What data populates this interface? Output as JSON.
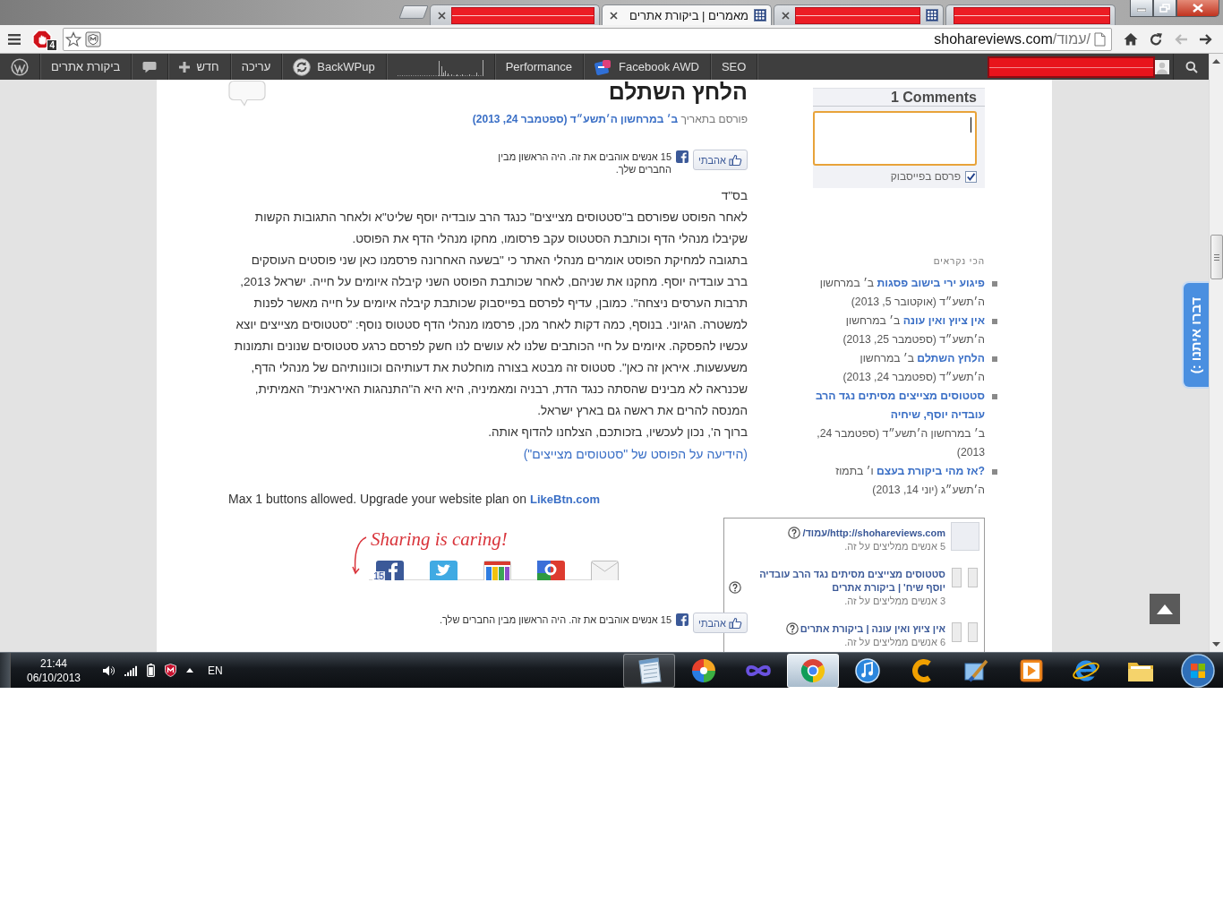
{
  "browser": {
    "tabs": [
      {
        "redacted": true,
        "closable": true,
        "favicon": false,
        "selected": false
      },
      {
        "redacted": false,
        "title": "מאמרים | ביקורת אתרים",
        "closable": true,
        "favicon": true,
        "selected": true
      },
      {
        "redacted": true,
        "closable": true,
        "favicon": true,
        "selected": false
      },
      {
        "redacted": true,
        "closable": false,
        "favicon": false,
        "selected": false
      }
    ],
    "extension_badge": "4",
    "address_bar": {
      "host": "shohareviews.com",
      "path": "/עמוד/"
    },
    "navigation": {
      "forward": {
        "disabled": true
      },
      "back": {
        "disabled": false
      }
    }
  },
  "admin_bar": {
    "items": [
      {
        "kind": "link",
        "label": "SEO"
      },
      {
        "kind": "facebook",
        "label": "Facebook AWD"
      },
      {
        "kind": "link",
        "label": "Performance"
      },
      {
        "kind": "graph"
      },
      {
        "kind": "backup",
        "label": "BackWPup"
      },
      {
        "kind": "link",
        "label": "עריכה"
      },
      {
        "kind": "new",
        "label": "חדש"
      },
      {
        "kind": "comments"
      },
      {
        "kind": "link",
        "label": "ביקורת אתרים"
      },
      {
        "kind": "logo"
      }
    ],
    "account": {
      "redacted": true
    }
  },
  "article": {
    "title": "הלחץ השתלם",
    "posted_label": "פורסם בתאריך",
    "date": "ב׳ במרחשון ה׳תשע״ד (ספטמבר 24, 2013)",
    "like_box_top": {
      "button": "אהבתי",
      "text": "15 אנשים אוהבים את זה. היה הראשון מבין החברים שלך."
    },
    "paragraphs": [
      [
        "בס\"ד"
      ],
      [
        "לאחר הפוסט שפורסם ב\"סטטוסים מצייצים\" כנגד הרב עובדיה יוסף שליט\"א ולאחר התגובות הקשות",
        "שקיבלו מנהלי הדף וכותבת הסטטוס עקב פרסומו, מחקו מנהלי הדף את הפוסט."
      ],
      [
        "בתגובה למחיקת הפוסט אומרים מנהלי האתר כי \"בשעה האחרונה פרסמנו כאן שני פוסטים העוסקים",
        "ברב עובדיה יוסף. מחקנו את שניהם, לאחר שכותבת הפוסט השני קיבלה איומים על חייה. ישראל 2013,",
        "תרבות הערסים ניצחה\". כמובן, עדיף לפרסם בפייסבוק שכותבת קיבלה איומים על חייה מאשר לפנות",
        "למשטרה. הגיוני. בנוסף, כמה דקות לאחר מכן, פרסמו מנהלי הדף סטטוס נוסף: \"סטטוסים מצייצים יוצא",
        "עכשיו להפסקה. איומים על חיי הכותבים שלנו לא עושים לנו חשק לפרסם כרגע סטטוסים שנונים ותמונות",
        "משעשעות. איראן זה כאן\". סטטוס זה מבטא בצורה מוחלטת את דעותיהם וכוונותיהם של מנהלי הדף,",
        "שכנראה לא מבינים שהסתה כנגד הדת, רבניה ומאמיניה, היא היא ה\"התנהגות האיראנית\" האמיתית,",
        "המנסה להרים את ראשה גם בארץ ישראל."
      ],
      [
        "ברוך ה', נכון לעכשיו, בזכותכם, הצלחנו להדוף אותה."
      ]
    ],
    "source_link": "(הידיעה על הפוסט של \"סטטוסים מצייצים\")",
    "upgrade_notice": {
      "text": "Max 1 buttons allowed. Upgrade your website plan on",
      "link": "LikeBtn.com"
    },
    "sharing": {
      "caption": "Sharing is caring!",
      "services": [
        {
          "kind": "facebook",
          "count": "15"
        },
        {
          "kind": "twitter"
        },
        {
          "kind": "bookmarks"
        },
        {
          "kind": "google"
        },
        {
          "kind": "email"
        }
      ]
    },
    "like_box_bottom": {
      "button": "אהבתי",
      "text": "15 אנשים אוהבים את זה. היה הראשון מבין החברים שלך."
    }
  },
  "sidebar": {
    "comments": {
      "title": "1 Comments",
      "field": {
        "focused": true
      },
      "post_to_facebook": {
        "label": "פרסם בפייסבוק",
        "checked": true
      }
    },
    "most_read": {
      "heading": "הכי נקראים",
      "items": [
        {
          "title": "פיגוע ירי בישוב פסגות",
          "date": "ב׳ במרחשון ה׳תשע״ד (אוקטובר 5, 2013)"
        },
        {
          "title": "אין ציוץ ואין עונה",
          "date": "ב׳ במרחשון ה׳תשע״ד (ספטמבר 25, 2013)"
        },
        {
          "title": "הלחץ השתלם",
          "date": "ב׳ במרחשון ה׳תשע״ד (ספטמבר 24, 2013)"
        },
        {
          "title": "סטטוסים מצייצים מסיתים נגד הרב עובדיה יוסף, שיחיה",
          "date": "ב׳ במרחשון ה׳תשע״ד (ספטמבר 24, 2013)"
        },
        {
          "title": "אז מהי ביקורת בעצם?",
          "date": "ו׳ בתמוז ה׳תשע״ג (יוני 14, 2013)"
        }
      ]
    },
    "recommendations": [
      {
        "kind": "page",
        "title": "http://shohareviews.com/עמוד/",
        "count": "5 אנשים ממליצים על זה."
      },
      {
        "kind": "article",
        "title": "סטטוסים מצייצים מסיתים נגד הרב עובדיה יוסף שיח' | ביקורת אתרים",
        "count": "3 אנשים ממליצים על זה."
      },
      {
        "kind": "article",
        "title": "אין ציוץ ואין עונה | ביקורת אתרים",
        "count": "6 אנשים ממליצים על זה."
      }
    ]
  },
  "feedback_tab": "דברו איתנו :)",
  "taskbar": {
    "time": "21:44",
    "date": "06/10/2013",
    "language": "EN",
    "apps": [
      {
        "running": true,
        "selected": false
      },
      {
        "running": false,
        "selected": false
      },
      {
        "running": false,
        "selected": false
      },
      {
        "running": true,
        "selected": true
      },
      {
        "running": false,
        "selected": false
      },
      {
        "running": false,
        "selected": false
      },
      {
        "running": false,
        "selected": false
      },
      {
        "running": false,
        "selected": false
      },
      {
        "running": false,
        "selected": false
      },
      {
        "running": false,
        "selected": false
      }
    ]
  }
}
